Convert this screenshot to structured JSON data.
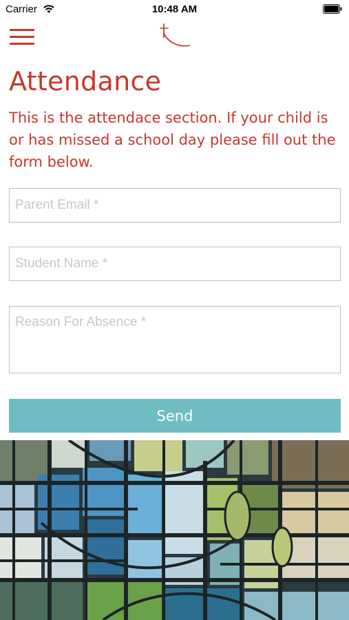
{
  "status_bar": {
    "carrier": "Carrier",
    "time": "10:48 AM"
  },
  "nav": {
    "menu_icon": "hamburger-icon",
    "logo_icon": "cross-logo-icon"
  },
  "page": {
    "title": "Attendance",
    "intro": "This is the attendace section. If your child is or has missed a school day please fill out the form below."
  },
  "form": {
    "parent_email": {
      "placeholder": "Parent Email *",
      "value": ""
    },
    "student_name": {
      "placeholder": "Student Name *",
      "value": ""
    },
    "reason": {
      "placeholder": "Reason For Absence *",
      "value": ""
    },
    "send_label": "Send"
  },
  "colors": {
    "accent": "#c9372c",
    "button": "#6fbcc2",
    "border": "#bdbdbd"
  },
  "footer_image": {
    "icon": "stained-glass-image"
  }
}
